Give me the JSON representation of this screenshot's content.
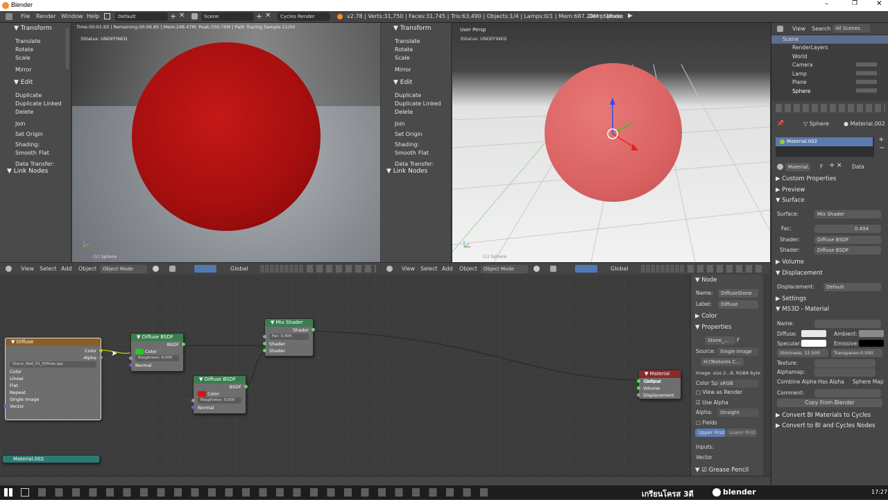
{
  "window": {
    "title": "Blender"
  },
  "menu": {
    "file": "File",
    "render": "Render",
    "window": "Window",
    "help": "Help"
  },
  "header": {
    "layout": "Default",
    "scene": "Scene",
    "engine": "Cycles Render",
    "stats": "v2.78 | Verts:31,750 | Faces:31,745 | Tris:63,490 | Objects:1/4 | Lamps:0/1 | Mem:687.20M | Sphere",
    "demo_mode": "Demo Mode:"
  },
  "toolshelf": {
    "transform_title": "Transform",
    "transform_items": [
      "Translate",
      "Rotate",
      "Scale"
    ],
    "mirror": "Mirror",
    "edit_title": "Edit",
    "edit_items": [
      "Duplicate",
      "Duplicate Linked",
      "Delete"
    ],
    "join": "Join",
    "set_origin": "Set Origin",
    "shading_label": "Shading:",
    "smooth": "Smooth",
    "flat": "Flat",
    "data_transfer": "Data Transfer:",
    "link_nodes": "Link Nodes"
  },
  "viewport_left": {
    "status": "Time:00:01.93 | Remaining:00:06.85 | Mem:248.47M, Peak:330.70M | Path Tracing Sample 11/50",
    "status2": "3Status: UNDEFINED",
    "object_label": "(1) Sphere",
    "colors": {
      "sphere": "#b01010",
      "floor": "#8a8f93"
    }
  },
  "viewport_right": {
    "title": "User Persp",
    "status2": "3Status: UNDEFINED",
    "object_label": "(1) Sphere",
    "colors": {
      "sphere": "#e06a6a"
    }
  },
  "view_header": {
    "view": "View",
    "select": "Select",
    "add": "Add",
    "object": "Object",
    "mode": "Object Mode",
    "global": "Global"
  },
  "outliner": {
    "view": "View",
    "search": "Search",
    "all_scenes": "All Scenes",
    "items": [
      "Scene",
      "RenderLayers",
      "World",
      "Camera",
      "Lamp",
      "Plane",
      "Sphere"
    ]
  },
  "properties": {
    "breadcrumb_obj": "Sphere",
    "breadcrumb_mat": "Material.002",
    "material_slot": "Material.002",
    "mat_name_field": "Material.",
    "mat_f": "F",
    "data_label": "Data",
    "sections": {
      "custom": "Custom Properties",
      "preview": "Preview",
      "surface": "Surface",
      "volume": "Volume",
      "displacement": "Displacement",
      "settings": "Settings",
      "ms3d": "MS3D - Material",
      "convert1": "Convert BI Materials to Cycles",
      "convert2": "Convert to BI and Cycles Nodes"
    },
    "surface_label": "Surface:",
    "surface_value": "Mix Shader",
    "fac_label": "Fac:",
    "fac_value": "0.404",
    "shader_label": "Shader:",
    "shader1": "Diffuse BSDF",
    "shader2": "Diffuse BSDF",
    "displacement_label": "Displacement:",
    "displacement_value": "Default",
    "ms3d": {
      "name": "Name:",
      "diffuse": "Diffuse:",
      "ambient": "Ambient:",
      "specular": "Specular:",
      "emissive": "Emissive:",
      "shininess": "Shininess: 12.500",
      "transparency": "Transparen:0.000",
      "texture": "Texture:",
      "alphamap": "Alphamap:",
      "combine_alpha": "Combine Alpha",
      "has_alpha": "Has Alpha",
      "sphere_map": "Sphere Map",
      "comment": "Comment:",
      "copy_from_blender": "Copy From Blender"
    }
  },
  "node_editor": {
    "nodes": {
      "diffuse_tex": {
        "title": "Diffuse",
        "out_color": "Color",
        "out_alpha": "Alpha",
        "image": "Stone_Wall_01_Diffuse.tga",
        "opts": [
          "Color",
          "Linear",
          "Flat",
          "Repeat",
          "Single Image"
        ],
        "vector": "Vector"
      },
      "bsdf1": {
        "title": "Diffuse BSDF",
        "out": "BSDF",
        "color": "Color",
        "roughness": "Roughness: 0.000",
        "normal": "Normal",
        "swatch": "#22cc22"
      },
      "bsdf2": {
        "title": "Diffuse BSDF",
        "out": "BSDF",
        "color": "Color",
        "roughness": "Roughness: 0.000",
        "normal": "Normal",
        "swatch": "#dd1111"
      },
      "mix": {
        "title": "Mix Shader",
        "out": "Shader",
        "fac": "Fac:",
        "fac_val": "0.404",
        "in1": "Shader",
        "in2": "Shader"
      },
      "output": {
        "title": "Material Output",
        "surface": "Surface",
        "volume": "Volume",
        "displacement": "Displacement"
      },
      "bottom_node": "Material.002"
    },
    "sidebar": {
      "node": "Node",
      "name_label": "Name:",
      "name_value": "DiffuseStone",
      "label_label": "Label:",
      "label_value": "Diffuse",
      "color": "Color",
      "properties": "Properties",
      "image_field": "Stone_...",
      "f": "F",
      "source_label": "Source:",
      "source_value": "Single Image",
      "path": "H:\\Textures C...",
      "image_info": "Image: size 2...8, RGBA byte",
      "color_sp_label": "Color Sp",
      "color_sp_value": "sRGB",
      "view_as_render": "View as Render",
      "use_alpha": "Use Alpha",
      "alpha_label": "Alpha:",
      "alpha_value": "Straight",
      "fields": "Fields",
      "upper_first": "Upper First",
      "lower_first": "Lower First",
      "inputs": "Inputs:",
      "vector": "Vector",
      "grease": "Grease Pencil Layers"
    }
  },
  "taskbar": {
    "brand": "เกรียนโครส 3ดี",
    "blender": "blender",
    "clock": "17:27"
  }
}
